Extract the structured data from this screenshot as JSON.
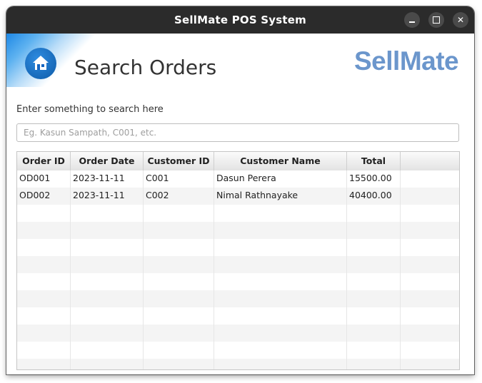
{
  "window": {
    "title": "SellMate POS System",
    "controls": {
      "minimize": "–",
      "maximize": "□",
      "close": "✕"
    }
  },
  "header": {
    "home_icon": "home-icon",
    "title": "Search Orders",
    "logo": "SellMate",
    "logo_color": "#6b96cc"
  },
  "search": {
    "label": "Enter something to search here",
    "value": "",
    "placeholder": "Eg. Kasun Sampath, C001, etc."
  },
  "table": {
    "columns": [
      "Order ID",
      "Order Date",
      "Customer ID",
      "Customer Name",
      "Total",
      ""
    ],
    "rows": [
      [
        "OD001",
        "2023-11-11",
        "C001",
        "Dasun Perera",
        "15500.00",
        ""
      ],
      [
        "OD002",
        "2023-11-11",
        "C002",
        "Nimal Rathnayake",
        "40400.00",
        ""
      ]
    ]
  },
  "colors": {
    "accent": "#1565c0",
    "titlebar": "#2b2b2b"
  }
}
